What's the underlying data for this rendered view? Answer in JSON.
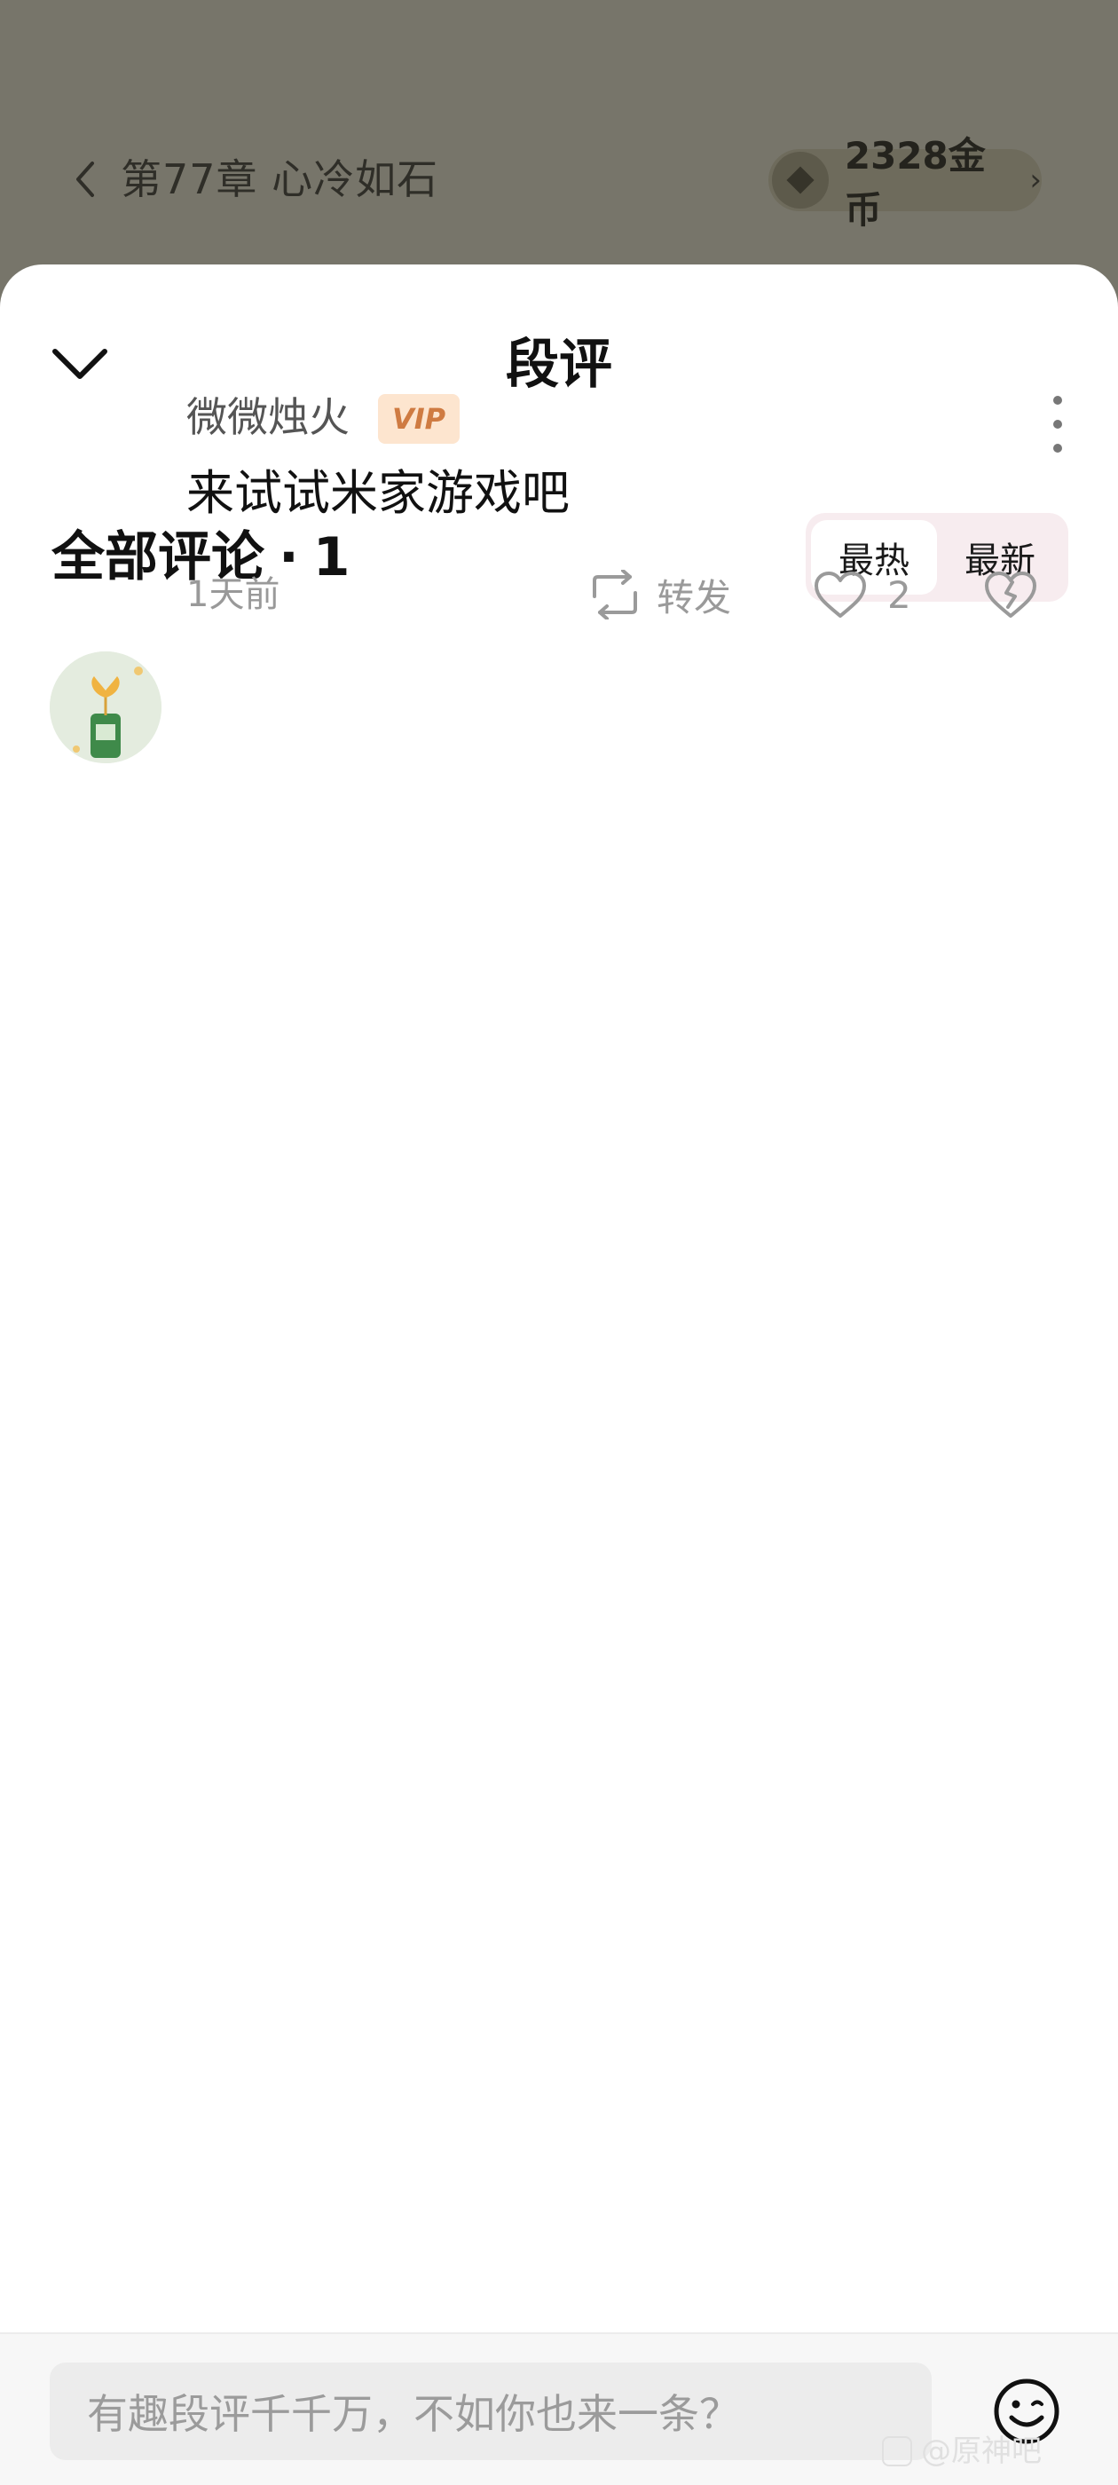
{
  "reader": {
    "chapter_title": "第77章 心冷如石",
    "coin_balance": "2328金币"
  },
  "sheet": {
    "title": "段评",
    "comments_label": "全部评论",
    "dot": "·",
    "comments_count": "1",
    "sort_options": [
      "最热",
      "最新"
    ],
    "active_sort": "最热"
  },
  "comments": [
    {
      "username": "微微烛火",
      "badge": "VIP",
      "text": "来试试米家游戏吧",
      "time": "1天前",
      "repost_label": "转发",
      "like_count": "2"
    }
  ],
  "input": {
    "placeholder": "有趣段评千千万，不如你也来一条？"
  },
  "watermark": "@原神吧"
}
